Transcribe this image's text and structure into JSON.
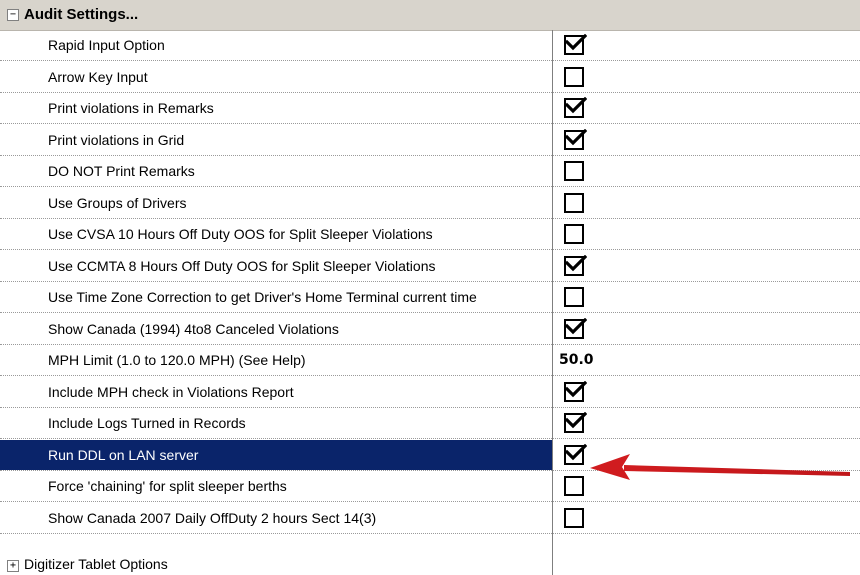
{
  "header": {
    "expander": "⊟",
    "title": "Audit Settings..."
  },
  "rows": [
    {
      "label": "Rapid Input Option",
      "type": "checkbox",
      "checked": true
    },
    {
      "label": "Arrow Key Input",
      "type": "checkbox",
      "checked": false
    },
    {
      "label": "Print violations in Remarks",
      "type": "checkbox",
      "checked": true
    },
    {
      "label": "Print violations in Grid",
      "type": "checkbox",
      "checked": true
    },
    {
      "label": "DO NOT Print Remarks",
      "type": "checkbox",
      "checked": false
    },
    {
      "label": "Use Groups of Drivers",
      "type": "checkbox",
      "checked": false
    },
    {
      "label": "Use CVSA 10 Hours Off Duty OOS for Split Sleeper Violations",
      "type": "checkbox",
      "checked": false
    },
    {
      "label": "Use CCMTA 8 Hours Off Duty OOS for Split Sleeper Violations",
      "type": "checkbox",
      "checked": true
    },
    {
      "label": "Use Time Zone Correction to get Driver's Home Terminal current time",
      "type": "checkbox",
      "checked": false
    },
    {
      "label": "Show Canada (1994) 4to8 Canceled Violations",
      "type": "checkbox",
      "checked": true
    },
    {
      "label": "MPH Limit (1.0 to 120.0 MPH) (See Help)",
      "type": "number",
      "value": "50.0"
    },
    {
      "label": "Include MPH check in Violations Report",
      "type": "checkbox",
      "checked": true
    },
    {
      "label": "Include Logs Turned in Records",
      "type": "checkbox",
      "checked": true
    },
    {
      "label": "Run DDL on LAN server",
      "type": "checkbox",
      "checked": true,
      "selected": true
    },
    {
      "label": "Force 'chaining' for split sleeper berths",
      "type": "checkbox",
      "checked": false
    },
    {
      "label": "Show Canada 2007 Daily OffDuty 2 hours Sect 14(3)",
      "type": "checkbox",
      "checked": false
    }
  ],
  "footer": {
    "expander": "⊞",
    "title": "Digitizer Tablet Options"
  },
  "colors": {
    "selection": "#0a246a",
    "header_bg": "#d8d4cc",
    "arrow": "#c0161a"
  }
}
